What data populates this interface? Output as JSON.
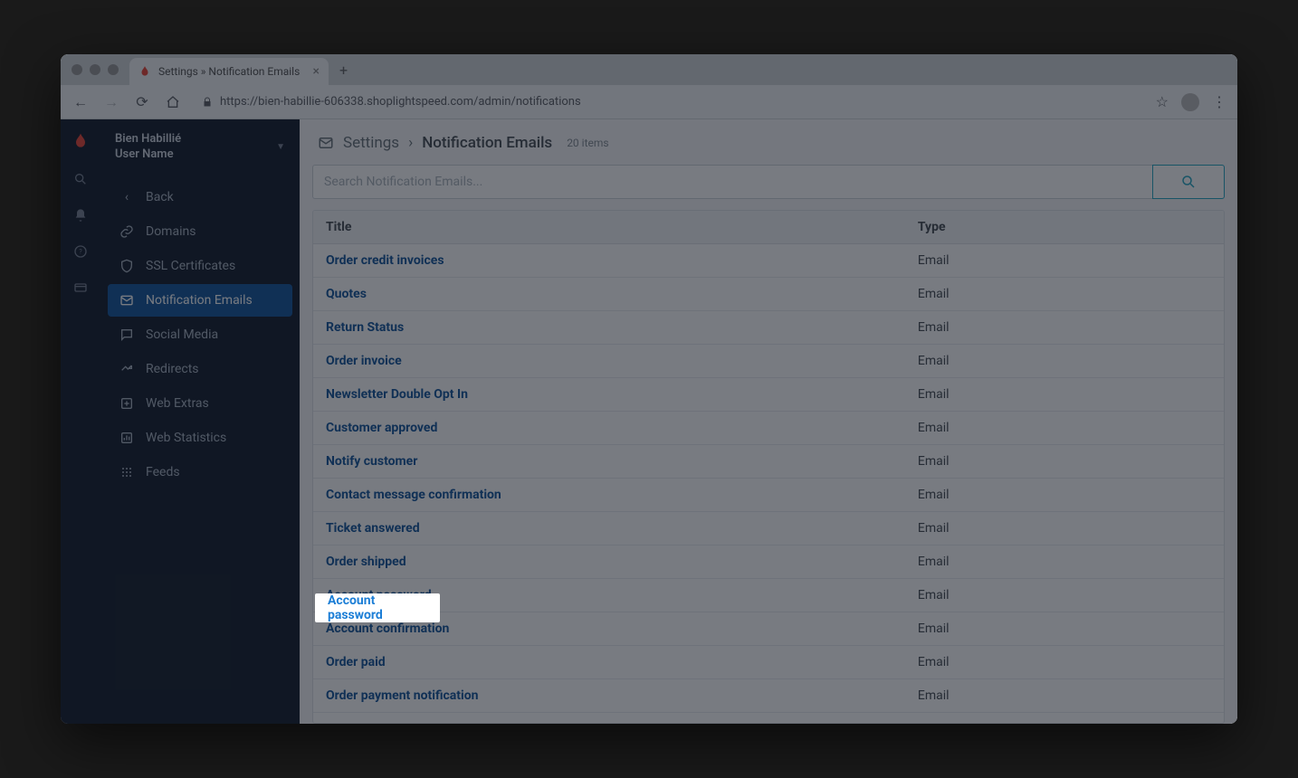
{
  "browser": {
    "tab_title": "Settings » Notification Emails",
    "url": "https://bien-habillie-606338.shoplightspeed.com/admin/notifications"
  },
  "account": {
    "shop_name": "Bien Habillié",
    "user_label": "User Name"
  },
  "sidebar": {
    "back": "Back",
    "items": [
      {
        "icon": "link",
        "label": "Domains"
      },
      {
        "icon": "shield",
        "label": "SSL Certificates"
      },
      {
        "icon": "envelope",
        "label": "Notification Emails",
        "active": true
      },
      {
        "icon": "chat",
        "label": "Social Media"
      },
      {
        "icon": "redirect",
        "label": "Redirects"
      },
      {
        "icon": "plus-box",
        "label": "Web Extras"
      },
      {
        "icon": "chart",
        "label": "Web Statistics"
      },
      {
        "icon": "grid-dots",
        "label": "Feeds"
      }
    ]
  },
  "header": {
    "crumb_root": "Settings",
    "crumb_leaf": "Notification Emails",
    "count_label": "20 items"
  },
  "search": {
    "placeholder": "Search Notification Emails..."
  },
  "table": {
    "columns": {
      "title": "Title",
      "type": "Type"
    },
    "rows": [
      {
        "title": "Order credit invoices",
        "type": "Email"
      },
      {
        "title": "Quotes",
        "type": "Email"
      },
      {
        "title": "Return Status",
        "type": "Email"
      },
      {
        "title": "Order invoice",
        "type": "Email"
      },
      {
        "title": "Newsletter Double Opt In",
        "type": "Email"
      },
      {
        "title": "Customer approved",
        "type": "Email"
      },
      {
        "title": "Notify customer",
        "type": "Email"
      },
      {
        "title": "Contact message confirmation",
        "type": "Email"
      },
      {
        "title": "Ticket answered",
        "type": "Email"
      },
      {
        "title": "Order shipped",
        "type": "Email"
      },
      {
        "title": "Account password",
        "type": "Email",
        "highlight": true
      },
      {
        "title": "Account confirmation",
        "type": "Email"
      },
      {
        "title": "Order paid",
        "type": "Email"
      },
      {
        "title": "Order payment notification",
        "type": "Email"
      }
    ]
  },
  "highlight_text": "Account password"
}
